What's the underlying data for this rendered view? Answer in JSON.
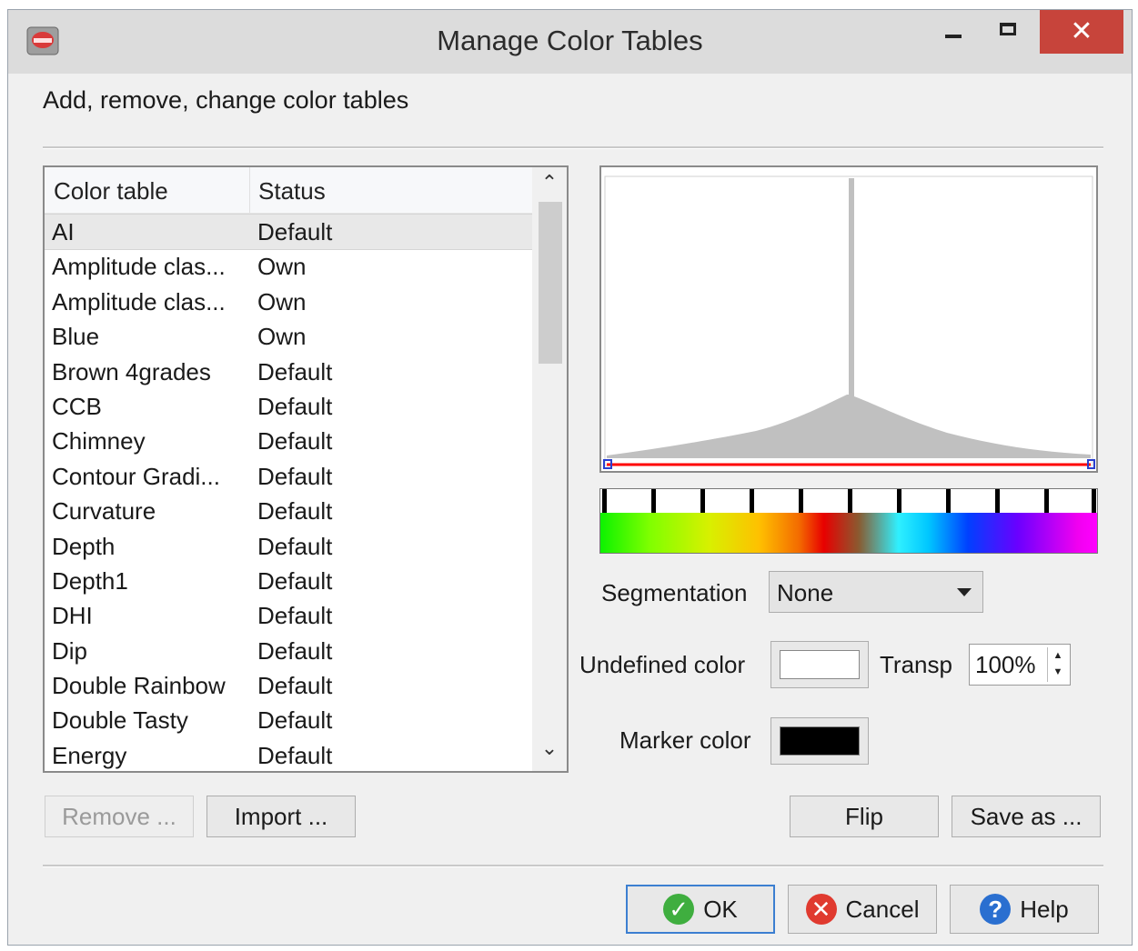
{
  "window": {
    "title": "Manage Color Tables",
    "close_glyph": "✕",
    "icons": {
      "app": "app-icon",
      "minimize": "minimize-icon",
      "maximize": "maximize-icon",
      "close": "close-icon"
    }
  },
  "caption": "Add, remove, change color tables",
  "list": {
    "columns": [
      "Color table",
      "Status"
    ],
    "rows": [
      {
        "name": "AI",
        "status": "Default"
      },
      {
        "name": "Amplitude clas...",
        "status": "Own"
      },
      {
        "name": "Amplitude clas...",
        "status": "Own"
      },
      {
        "name": "Blue",
        "status": "Own"
      },
      {
        "name": "Brown 4grades",
        "status": "Default"
      },
      {
        "name": "CCB",
        "status": "Default"
      },
      {
        "name": "Chimney",
        "status": "Default"
      },
      {
        "name": "Contour Gradi...",
        "status": "Default"
      },
      {
        "name": "Curvature",
        "status": "Default"
      },
      {
        "name": "Depth",
        "status": "Default"
      },
      {
        "name": "Depth1",
        "status": "Default"
      },
      {
        "name": "DHI",
        "status": "Default"
      },
      {
        "name": "Dip",
        "status": "Default"
      },
      {
        "name": "Double Rainbow",
        "status": "Default"
      },
      {
        "name": "Double Tasty",
        "status": "Default"
      },
      {
        "name": "Energy",
        "status": "Default"
      }
    ],
    "selected_index": 0,
    "scroll_up_glyph": "⌃",
    "scroll_down_glyph": "⌄"
  },
  "buttons": {
    "remove": "Remove ...",
    "import": "Import ...",
    "flip": "Flip",
    "save_as": "Save as ...",
    "ok": "OK",
    "cancel": "Cancel",
    "help": "Help"
  },
  "dialog_icons": {
    "ok": "✓",
    "cancel": "✕",
    "help": "?"
  },
  "segmentation": {
    "label": "Segmentation",
    "value": "None"
  },
  "undefined_color": {
    "label": "Undefined color",
    "color": "#ffffff"
  },
  "transparency": {
    "label": "Transp",
    "value": "100%"
  },
  "marker_color": {
    "label": "Marker color",
    "color": "#000000"
  },
  "colors": {
    "histogram_fill": "#c0c0c0",
    "range_line": "#ff0000",
    "default_button_border": "#3c7fd1",
    "close_button": "#c7443b"
  }
}
